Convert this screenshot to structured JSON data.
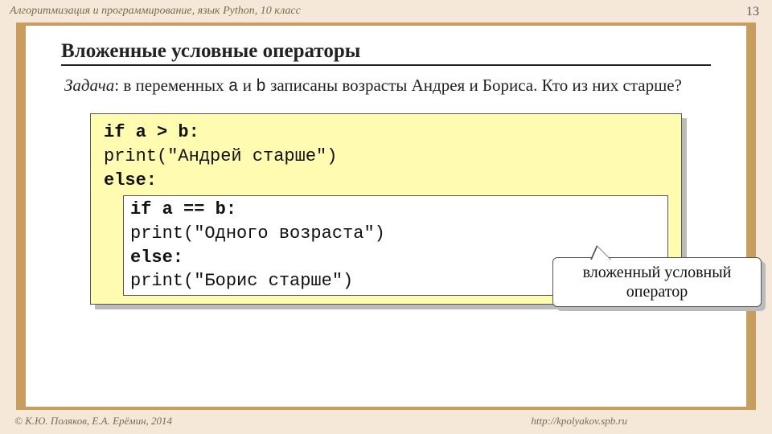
{
  "header": "Алгоритмизация и программирование, язык Python, 10 класс",
  "page": "13",
  "title": "Вложенные условные операторы",
  "task": {
    "label": "Задача",
    "before_a": ": в переменных ",
    "a": "a",
    "mid": " и ",
    "b": "b",
    "after_b": " записаны возрасты Андрея и Бориса. Кто из них старше?"
  },
  "code": {
    "l1": "if a > b:",
    "l2": "  print(\"Андрей старше\")",
    "l3": "else:",
    "inner": {
      "l1": "if a == b:",
      "l2": "  print(\"Одного возраста\")",
      "l3": "else:",
      "l4": "  print(\"Борис старше\")"
    }
  },
  "callout": "вложенный условный оператор",
  "footer_left": "© К.Ю. Поляков, Е.А. Ерёмин, 2014",
  "footer_right": "http://kpolyakov.spb.ru"
}
